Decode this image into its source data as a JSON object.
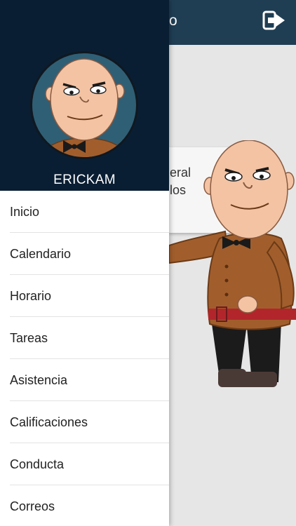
{
  "topbar": {
    "title_fragment": "o",
    "logout_icon": "logout-icon"
  },
  "card": {
    "line1": "eral",
    "line2": "los"
  },
  "drawer": {
    "username": "ERICKAM",
    "avatar_icon": "avatar-icon",
    "menu": [
      {
        "label": "Inicio"
      },
      {
        "label": "Calendario"
      },
      {
        "label": "Horario"
      },
      {
        "label": "Tareas"
      },
      {
        "label": "Asistencia"
      },
      {
        "label": "Calificaciones"
      },
      {
        "label": "Conducta"
      },
      {
        "label": "Correos"
      }
    ]
  },
  "colors": {
    "topbar": "#1f3e54",
    "drawer_header": "#0a1e33",
    "avatar_bg": "#2f5f75"
  }
}
